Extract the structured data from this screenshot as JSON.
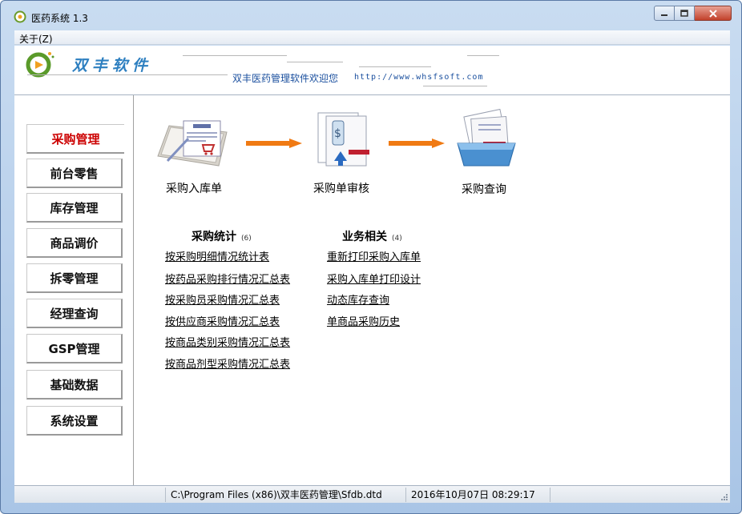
{
  "window": {
    "title": "医药系统 1.3"
  },
  "menu": {
    "about": "关于(Z)"
  },
  "banner": {
    "logo_text": "双丰软件",
    "slogan": "双丰医药管理软件欢迎您",
    "url": "http://www.whsfsoft.com"
  },
  "sidebar": {
    "items": [
      {
        "label": "采购管理",
        "active": true
      },
      {
        "label": "前台零售"
      },
      {
        "label": "库存管理"
      },
      {
        "label": "商品调价"
      },
      {
        "label": "拆零管理"
      },
      {
        "label": "经理查询"
      },
      {
        "label": "GSP管理"
      },
      {
        "label": "基础数据"
      },
      {
        "label": "系统设置"
      }
    ]
  },
  "workflow": {
    "steps": [
      {
        "label": "采购入库单",
        "icon": "purchase-receipt-icon"
      },
      {
        "label": "采购单审核",
        "icon": "purchase-audit-icon"
      },
      {
        "label": "采购查询",
        "icon": "purchase-query-icon"
      }
    ],
    "arrow_color": "#f07a13"
  },
  "sections": {
    "stats": {
      "title": "采购统计",
      "count": "(6)",
      "links": [
        "按采购明细情况统计表",
        "按药品采购排行情况汇总表",
        "按采购员采购情况汇总表",
        "按供应商采购情况汇总表",
        "按商品类别采购情况汇总表",
        "按商品剂型采购情况汇总表"
      ]
    },
    "business": {
      "title": "业务相关",
      "count": "(4)",
      "links": [
        "重新打印采购入库单",
        "采购入库单打印设计",
        "动态库存查询",
        "单商品采购历史"
      ]
    }
  },
  "status": {
    "path": "C:\\Program Files (x86)\\双丰医药管理\\Sfdb.dtd",
    "datetime": "2016年10月07日 08:29:17"
  },
  "colors": {
    "active_nav": "#cc0000",
    "brand_blue": "#2d7fc0"
  }
}
